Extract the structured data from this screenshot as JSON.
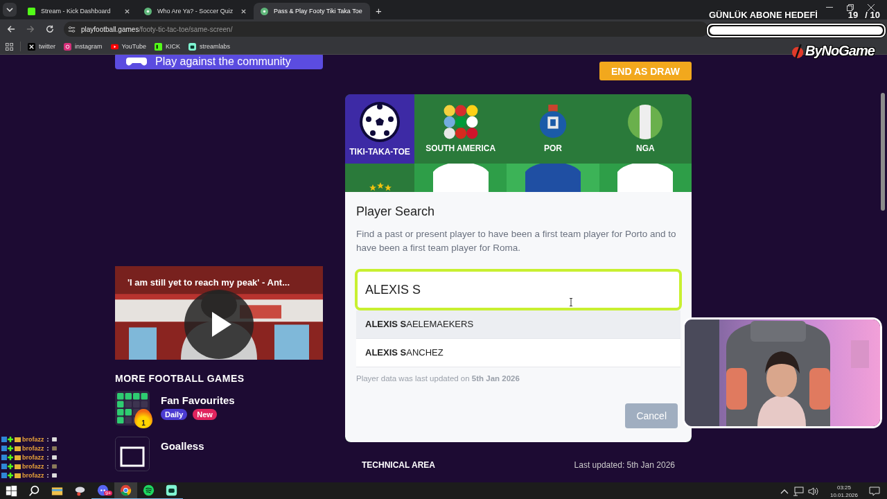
{
  "browser": {
    "tabs": [
      {
        "title": "Stream - Kick Dashboard",
        "kind": "kick",
        "selected": false
      },
      {
        "title": "Who Are Ya? - Soccer Quiz",
        "kind": "quiz",
        "selected": false
      },
      {
        "title": "Pass & Play Footy Tiki Taka Toe",
        "kind": "quiz",
        "selected": true
      }
    ],
    "new_tab": "+",
    "url_host": "playfootball.games",
    "url_path": "/footy-tic-tac-toe/same-screen/",
    "bookmarks": [
      {
        "label": "twitter",
        "kind": "x"
      },
      {
        "label": "instagram",
        "kind": "instagram"
      },
      {
        "label": "YouTube",
        "kind": "youtube"
      },
      {
        "label": "KICK",
        "kind": "kick"
      },
      {
        "label": "streamlabs",
        "kind": "streamlabs"
      }
    ]
  },
  "page": {
    "community_button": "Play against the community",
    "video": {
      "title": "'I am still yet to reach my peak' - Ant..."
    },
    "more_games": {
      "heading": "MORE FOOTBALL GAMES",
      "games": [
        {
          "title": "Fan Favourites",
          "kind": "grid",
          "icon_badge": "1",
          "tags": [
            {
              "label": "Daily",
              "color": "#4b3bd1"
            },
            {
              "label": "New",
              "color": "#e0245e"
            }
          ]
        },
        {
          "title": "Goalless",
          "kind": "goal"
        }
      ]
    },
    "end_draw_button": "END AS DRAW",
    "board": {
      "logo": "TIKI-TAKA-TOE",
      "columns": [
        {
          "label": "SOUTH AMERICA",
          "kind": "flags"
        },
        {
          "label": "POR",
          "kind": "crest"
        },
        {
          "label": "NGA",
          "kind": "flag"
        }
      ],
      "row_cells": [
        {
          "kind": "stars",
          "selected": false
        },
        {
          "kind": "jersey-white",
          "selected": false
        },
        {
          "kind": "jersey-blue",
          "selected": true
        },
        {
          "kind": "jersey-white",
          "selected": false
        }
      ]
    },
    "search": {
      "title": "Player Search",
      "prompt": "Find a past or present player to have been a first team player for Porto and to have been a first team player for Roma.",
      "value": "ALEXIS S",
      "results": [
        {
          "name": "**ALEXIS S**AELEMAEKERS",
          "selected": true
        },
        {
          "name": "**ALEXIS S**ANCHEZ",
          "selected": false
        }
      ],
      "note": "Player data was last updated on **5th Jan 2026**",
      "cancel": "Cancel"
    },
    "footer": {
      "left": "TECHNICAL AREA",
      "right": "Last updated: 5th Jan 2026"
    }
  },
  "overlay": {
    "goal_label": "GÜNLÜK ABONE HEDEFİ",
    "goal_count": "19",
    "goal_target": "/ 10",
    "level": 1,
    "logo": "ByNoGame",
    "chat": [
      {
        "user": "brofazz",
        "separator": ":"
      },
      {
        "user": "brofazz",
        "separator": ":"
      },
      {
        "user": "brofazz",
        "separator": ":"
      },
      {
        "user": "brofazz",
        "separator": ":"
      },
      {
        "user": "brofazz",
        "separator": ":"
      }
    ]
  },
  "taskbar": {
    "apps": [
      {
        "kind": "start",
        "running": false,
        "selected": false
      },
      {
        "kind": "search",
        "running": false,
        "selected": false
      },
      {
        "kind": "files",
        "running": false,
        "selected": false
      },
      {
        "kind": "tool",
        "running": false,
        "selected": false
      },
      {
        "kind": "discord",
        "badge": "9+",
        "running": true,
        "selected": false
      },
      {
        "kind": "chrome",
        "running": true,
        "selected": true
      },
      {
        "kind": "spotify",
        "running": true,
        "selected": false
      },
      {
        "kind": "bot",
        "running": true,
        "selected": false
      }
    ],
    "time": "03:25",
    "date": "10.01.2026"
  }
}
